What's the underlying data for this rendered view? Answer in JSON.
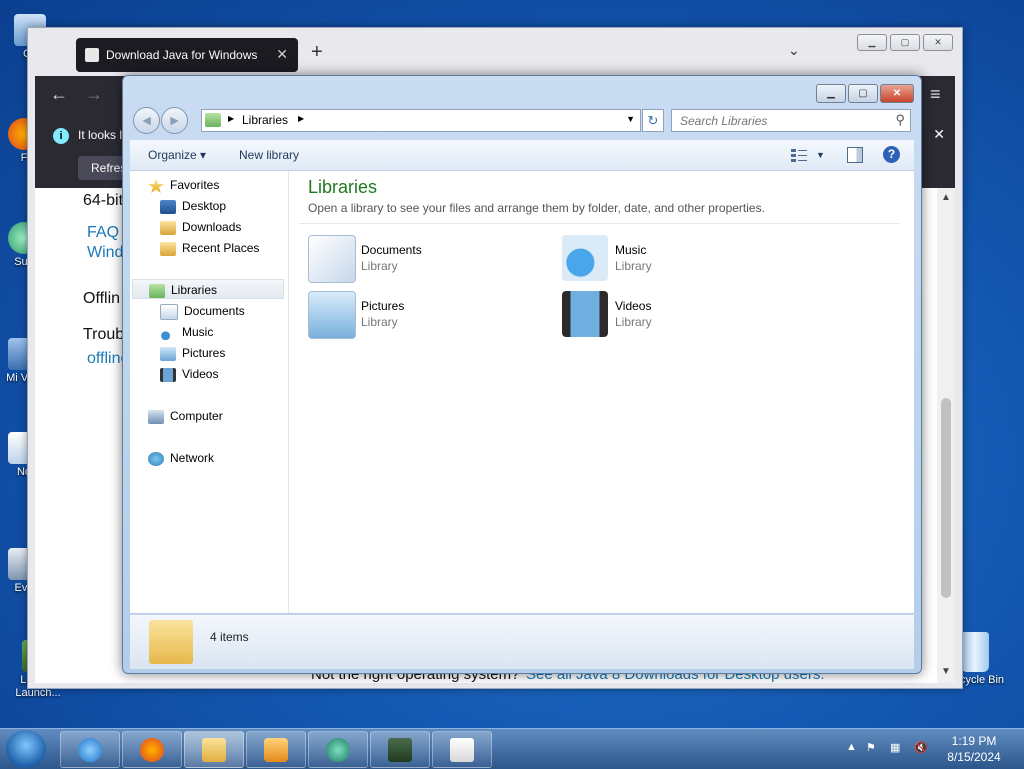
{
  "desktop": {
    "icons": [
      {
        "label": "Co"
      },
      {
        "label": "F"
      },
      {
        "label": "Sup"
      },
      {
        "label": "Mi Visu"
      },
      {
        "label": "No"
      },
      {
        "label": "Eve"
      },
      {
        "label": "Legacy Launch..."
      },
      {
        "label": "Recycle Bin"
      }
    ]
  },
  "browser": {
    "tab_title": "Download Java for Windows",
    "tab_close": "✕",
    "new_tab": "+",
    "list_tabs": "⌄",
    "back": "←",
    "forward": "→",
    "menu": "≡",
    "info_text": "It looks l",
    "refresh_label": "Refres",
    "info_close": "✕",
    "content": {
      "line1": "64-bit",
      "link1": "FAQ a",
      "link2": "Windo",
      "heading": "Offlin",
      "text2": "Troub",
      "link3": "offline",
      "bottom_text": "Not the right operating system?",
      "bottom_link": "See all Java 8 Downloads for Desktop users."
    }
  },
  "explorer": {
    "window_buttons": {
      "minimize": "▁",
      "maximize": "▢",
      "close": "✕"
    },
    "nav": {
      "back": "◄",
      "forward": "►"
    },
    "address": {
      "crumb": "Libraries",
      "sep": "▶",
      "dropdown": "▼"
    },
    "search": {
      "placeholder": "Search Libraries",
      "icon": "⚲"
    },
    "toolbar": {
      "organize": "Organize ▾",
      "new_library": "New library",
      "help": "?"
    },
    "navpane": {
      "favorites": "Favorites",
      "fav_items": [
        "Desktop",
        "Downloads",
        "Recent Places"
      ],
      "libraries": "Libraries",
      "lib_items": [
        "Documents",
        "Music",
        "Pictures",
        "Videos"
      ],
      "computer": "Computer",
      "network": "Network"
    },
    "main": {
      "title": "Libraries",
      "subtitle": "Open a library to see your files and arrange them by folder, date, and other properties.",
      "libraries": [
        {
          "name": "Documents",
          "type": "Library"
        },
        {
          "name": "Music",
          "type": "Library"
        },
        {
          "name": "Pictures",
          "type": "Library"
        },
        {
          "name": "Videos",
          "type": "Library"
        }
      ]
    },
    "details": {
      "count": "4 items"
    }
  },
  "taskbar": {
    "clock_time": "1:19 PM",
    "clock_date": "8/15/2024",
    "tray_arrow": "▲"
  }
}
